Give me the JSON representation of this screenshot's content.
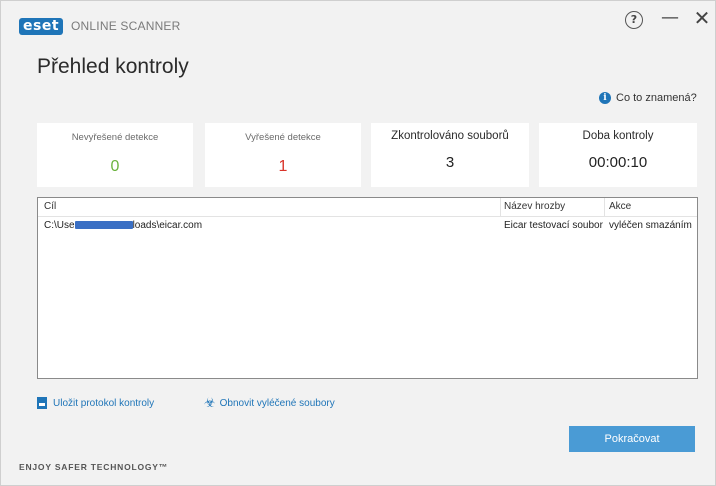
{
  "titlebar": {
    "logo_text": "eset",
    "product": "ONLINE SCANNER",
    "help_glyph": "?",
    "minimize_glyph": "—",
    "close_glyph": "✕"
  },
  "page_title": "Přehled kontroly",
  "info_link": {
    "icon": "info-icon",
    "label": "Co to znamená?"
  },
  "summary": [
    {
      "label": "Nevyřešené detekce",
      "value": "0",
      "color": "#6bb33f"
    },
    {
      "label": "Vyřešené detekce",
      "value": "1",
      "color": "#d9332a"
    },
    {
      "label": "Zkontrolováno souborů",
      "value": "3"
    },
    {
      "label": "Doba kontroly",
      "value": "00:00:10"
    }
  ],
  "table": {
    "columns": [
      "Cíl",
      "Název hrozby",
      "Akce"
    ],
    "rows": [
      {
        "target_prefix": "C:\\Use",
        "target_suffix": "loads\\eicar.com",
        "threat": "Eicar testovací soubor",
        "action": "vyléčen smazáním"
      }
    ]
  },
  "actions": {
    "save_log": "Uložit protokol kontroly",
    "restore": "Obnovit vyléčené soubory"
  },
  "continue_button": "Pokračovat",
  "footer": "ENJOY SAFER TECHNOLOGY™",
  "colors": {
    "accent": "#1f75b8",
    "button": "#4a9bd5"
  }
}
